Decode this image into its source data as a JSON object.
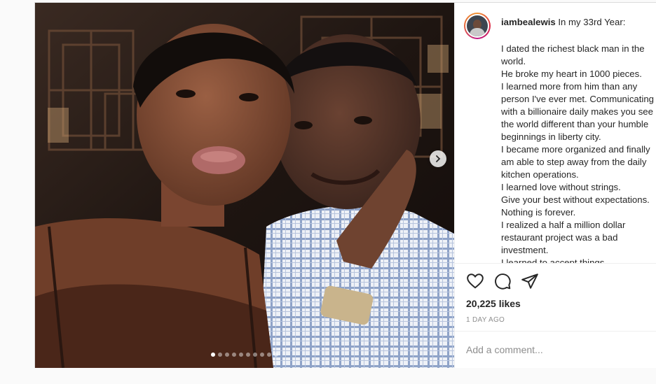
{
  "post": {
    "username": "iambealewis",
    "caption_first": "In my 33rd Year:",
    "caption_lines": [
      "I dated the richest black man in the",
      "world.",
      "He broke my heart in 1000 pieces.",
      "I learned more from him than any",
      "person I've ever met. Communicating",
      "with a billionaire daily makes you see",
      "the world different than your humble",
      "beginnings in liberty city.",
      "I became more organized and finally",
      "am able to step away from the daily",
      "kitchen operations.",
      "I learned love without strings.",
      "Give your best without expectations.",
      "Nothing is forever.",
      "I realized a half a million dollar",
      "restaurant project was a bad",
      "investment.",
      "I learned to accept things"
    ],
    "likes": "20,225 likes",
    "time": "1 DAY AGO",
    "comment_placeholder": "Add a comment...",
    "carousel": {
      "total": 10,
      "active": 0
    }
  },
  "icons": {
    "like": "heart-icon",
    "comment": "comment-bubble-icon",
    "share": "paper-plane-icon",
    "next": "chevron-right-icon"
  },
  "colors": {
    "text": "#262626",
    "muted": "#8e8e8e",
    "border": "#dbdbdb",
    "ring_start": "#f09433",
    "ring_end": "#bc1888"
  }
}
